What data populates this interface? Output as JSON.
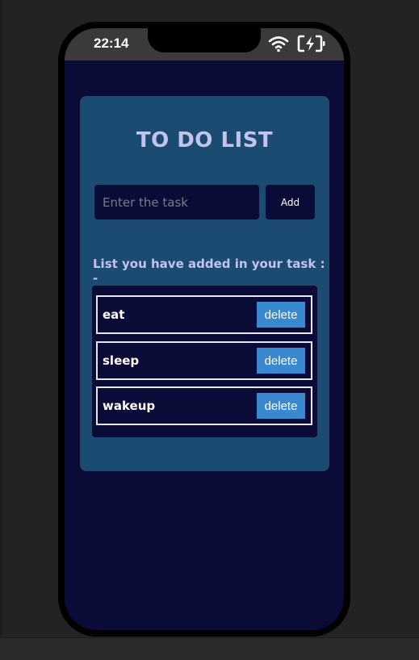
{
  "status_bar": {
    "time": "22:14",
    "wifi_icon": "wifi-icon",
    "battery_icon": "battery-charging-icon"
  },
  "app": {
    "title": "TO DO LIST",
    "input_placeholder": "Enter the task",
    "input_value": "",
    "add_label": "Add",
    "list_heading": "List you have added in your task : -",
    "tasks": [
      {
        "label": "eat",
        "delete_label": "delete"
      },
      {
        "label": "sleep",
        "delete_label": "delete"
      },
      {
        "label": "wakeup",
        "delete_label": "delete"
      }
    ]
  },
  "colors": {
    "screen_bg": "#0b0b37",
    "card_bg": "#1c4b72",
    "title_color": "#c3c4ee",
    "delete_button": "#3a88d0"
  }
}
